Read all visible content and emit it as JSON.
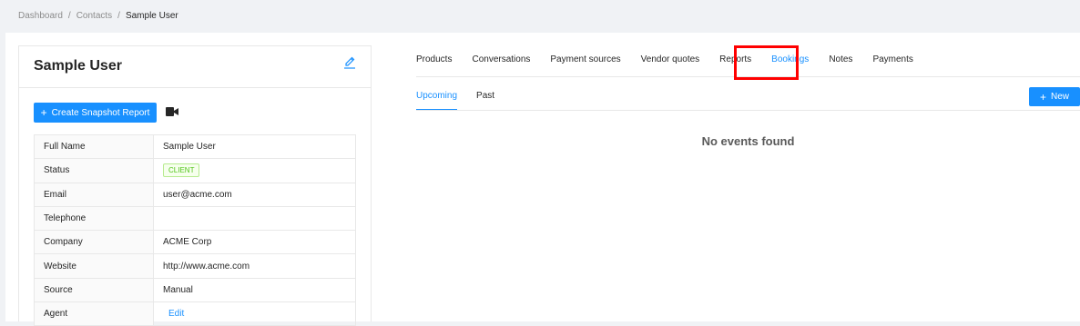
{
  "breadcrumb": {
    "items": [
      "Dashboard",
      "Contacts"
    ],
    "separator": "/",
    "current": "Sample User"
  },
  "card": {
    "title": "Sample User",
    "edit_icon": "pencil-icon",
    "snapshot_button": {
      "plus": "+",
      "label": "Create Snapshot Report"
    },
    "video_icon": "video-camera-icon"
  },
  "details": [
    {
      "label": "Full Name",
      "value": "Sample User"
    },
    {
      "label": "Status",
      "value": "CLIENT"
    },
    {
      "label": "Email",
      "value": "user@acme.com"
    },
    {
      "label": "Telephone",
      "value": ""
    },
    {
      "label": "Company",
      "value": "ACME Corp"
    },
    {
      "label": "Website",
      "value": "http://www.acme.com"
    },
    {
      "label": "Source",
      "value": "Manual"
    },
    {
      "label": "Agent",
      "value": "Edit"
    }
  ],
  "tabs": [
    {
      "label": "Products"
    },
    {
      "label": "Conversations"
    },
    {
      "label": "Payment sources"
    },
    {
      "label": "Vendor quotes"
    },
    {
      "label": "Reports"
    },
    {
      "label": "Bookings"
    },
    {
      "label": "Notes"
    },
    {
      "label": "Payments"
    }
  ],
  "active_tab": "Bookings",
  "subtabs": [
    {
      "label": "Upcoming"
    },
    {
      "label": "Past"
    }
  ],
  "active_subtab": "Upcoming",
  "new_button": {
    "plus": "+",
    "label": "New"
  },
  "empty_state": "No events found",
  "colors": {
    "accent": "#1890ff",
    "highlight": "#ff0000",
    "status_green": "#52c41a"
  }
}
